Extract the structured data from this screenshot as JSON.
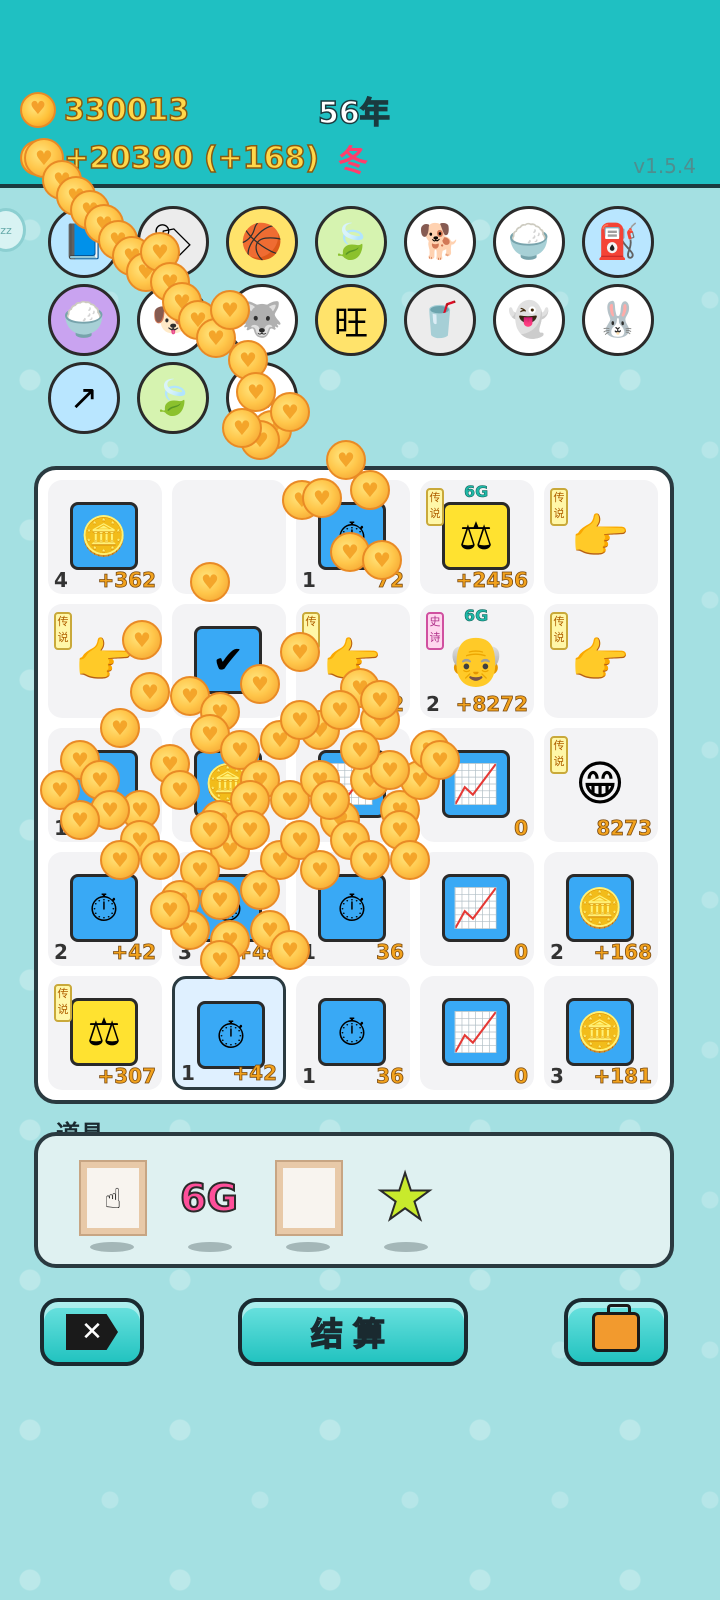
{
  "header": {
    "coins": "330013",
    "income": "+20390 (+168)",
    "year": "56年",
    "season": "冬",
    "version": "v1.5.4",
    "side_badge": "zz"
  },
  "items": [
    {
      "icon": "📘",
      "color": "blue"
    },
    {
      "icon": "🏷",
      "color": "grey"
    },
    {
      "icon": "🏀",
      "color": "yellow"
    },
    {
      "icon": "🍃",
      "color": "lightgreen"
    },
    {
      "icon": "🐕",
      "color": ""
    },
    {
      "icon": "🍚",
      "color": ""
    },
    {
      "icon": "⛽",
      "color": "blue"
    },
    {
      "icon": "🍚",
      "color": "purple"
    },
    {
      "icon": "🐶",
      "color": ""
    },
    {
      "icon": "🐺",
      "color": ""
    },
    {
      "icon": "旺",
      "color": "yellow"
    },
    {
      "icon": "🥤",
      "color": "grey"
    },
    {
      "icon": "👻",
      "color": ""
    },
    {
      "icon": "🐰",
      "color": ""
    },
    {
      "icon": "↗",
      "color": "blue"
    },
    {
      "icon": "🍃",
      "color": "lightgreen"
    },
    {
      "icon": "✖",
      "color": ""
    }
  ],
  "board": {
    "tiles": [
      {
        "icon": "🪙",
        "style": "blue",
        "level": "4",
        "bonus": "+362",
        "tag": "",
        "net": ""
      },
      {
        "icon": "",
        "style": "none",
        "level": "",
        "bonus": "",
        "tag": "",
        "net": ""
      },
      {
        "icon": "⏱",
        "style": "blue",
        "level": "1",
        "bonus": "72",
        "tag": "",
        "net": ""
      },
      {
        "icon": "⚖",
        "style": "yellow",
        "level": "",
        "bonus": "+2456",
        "tag": "传说",
        "net": "6G"
      },
      {
        "icon": "👉",
        "style": "none",
        "level": "",
        "bonus": "",
        "tag": "传说",
        "net": ""
      },
      {
        "icon": "👉",
        "style": "none",
        "level": "",
        "bonus": "",
        "tag": "传说",
        "net": ""
      },
      {
        "icon": "✔",
        "style": "blue",
        "level": "",
        "bonus": "",
        "tag": "",
        "net": ""
      },
      {
        "icon": "👉",
        "style": "none",
        "level": "",
        "bonus": "2",
        "tag": "传",
        "net": ""
      },
      {
        "icon": "👴",
        "style": "none",
        "level": "2",
        "bonus": "+8272",
        "tag": "史诗",
        "net": "6G"
      },
      {
        "icon": "👉",
        "style": "none",
        "level": "",
        "bonus": "",
        "tag": "传说",
        "net": ""
      },
      {
        "icon": "⏱",
        "style": "blue",
        "level": "1",
        "bonus": "",
        "tag": "",
        "net": ""
      },
      {
        "icon": "🪙",
        "style": "blue",
        "level": "",
        "bonus": "",
        "tag": "",
        "net": ""
      },
      {
        "icon": "📈",
        "style": "blue",
        "level": "",
        "bonus": "",
        "tag": "",
        "net": ""
      },
      {
        "icon": "📈",
        "style": "blue",
        "level": "",
        "bonus": "0",
        "tag": "",
        "net": ""
      },
      {
        "icon": "😁",
        "style": "none",
        "level": "",
        "bonus": "8273",
        "tag": "传说",
        "net": ""
      },
      {
        "icon": "⏱",
        "style": "blue",
        "level": "2",
        "bonus": "+42",
        "tag": "",
        "net": ""
      },
      {
        "icon": "⏱",
        "style": "blue",
        "level": "3",
        "bonus": "+48",
        "tag": "",
        "net": ""
      },
      {
        "icon": "⏱",
        "style": "blue",
        "level": "1",
        "bonus": "36",
        "tag": "",
        "net": ""
      },
      {
        "icon": "📈",
        "style": "blue",
        "level": "",
        "bonus": "0",
        "tag": "",
        "net": ""
      },
      {
        "icon": "🪙",
        "style": "blue",
        "level": "2",
        "bonus": "+168",
        "tag": "",
        "net": ""
      },
      {
        "icon": "⚖",
        "style": "yellow",
        "level": "",
        "bonus": "+307",
        "tag": "传说",
        "net": ""
      },
      {
        "icon": "⏱",
        "style": "blue",
        "level": "1",
        "bonus": "+42",
        "tag": "",
        "net": "",
        "highlight": true
      },
      {
        "icon": "⏱",
        "style": "blue",
        "level": "1",
        "bonus": "36",
        "tag": "",
        "net": ""
      },
      {
        "icon": "📈",
        "style": "blue",
        "level": "",
        "bonus": "0",
        "tag": "",
        "net": ""
      },
      {
        "icon": "🪙",
        "style": "blue",
        "level": "3",
        "bonus": "+181",
        "tag": "",
        "net": ""
      }
    ]
  },
  "props": {
    "label": "道具",
    "six_g": "6G",
    "items": [
      "pointer-frame",
      "6G",
      "empty-frame",
      "star"
    ]
  },
  "buttons": {
    "exit_label": "✕",
    "settle_label": "结算",
    "bag_label": "bag"
  },
  "colors": {
    "header_bg": "#1fc0c2",
    "coin_text": "#ffd84a",
    "season": "#ff3e6c",
    "tile_blue": "#39a9f5",
    "tile_yellow": "#ffe230",
    "bonus": "#f2a21d",
    "button": "#22c3c0"
  }
}
